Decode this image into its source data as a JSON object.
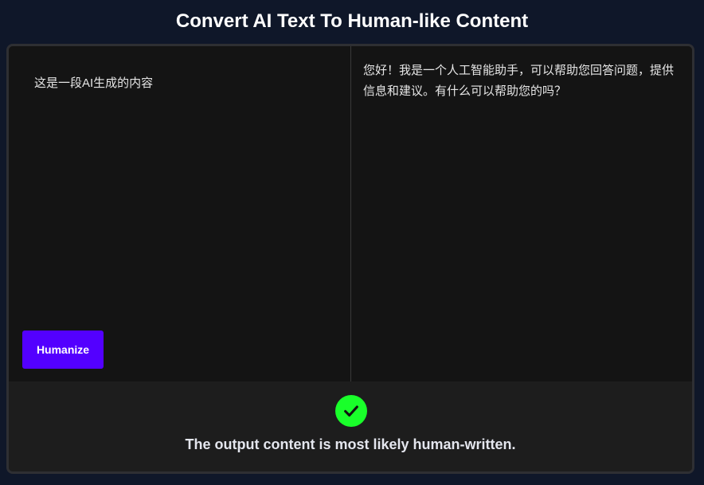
{
  "header": {
    "title": "Convert AI Text To Human-like Content"
  },
  "editor": {
    "input_text": "这是一段AI生成的内容",
    "output_text": "您好！我是一个人工智能助手，可以帮助您回答问题，提供信息和建议。有什么可以帮助您的吗？",
    "humanize_label": "Humanize"
  },
  "result": {
    "status_icon": "check-icon",
    "message": "The output content is most likely human-written."
  },
  "colors": {
    "page_background": "#0f1729",
    "accent_button": "#5300ff",
    "success_green": "#19ff2a"
  }
}
